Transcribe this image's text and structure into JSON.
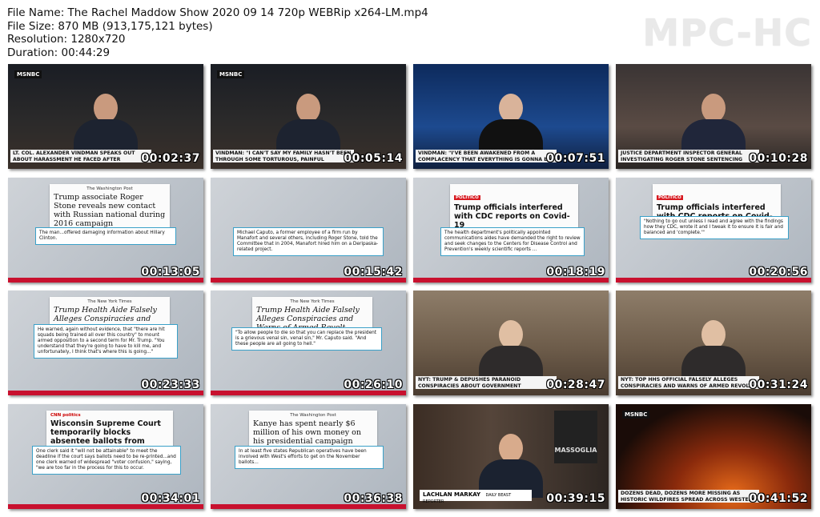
{
  "header": {
    "file_name": "File Name: The Rachel Maddow Show 2020 09 14 720p WEBRip x264-LM.mp4",
    "file_size": "File Size: 870 MB (913,175,121 bytes)",
    "resolution": "Resolution: 1280x720",
    "duration": "Duration: 00:44:29",
    "brand": "MPC-HC"
  },
  "colors": {
    "accent_red": "#c8102e",
    "quote_border": "#3aa0c8"
  },
  "thumbs": [
    {
      "time": "00:02:37",
      "caption": "LT. COL. ALEXANDER VINDMAN SPEAKS OUT ABOUT HARASSMENT HE FACED AFTER TESTIFYING AGAINST TRUMP",
      "network": "MSNBC"
    },
    {
      "time": "00:05:14",
      "caption": "VINDMAN: \"I CAN'T SAY MY FAMILY HASN'T BEEN THROUGH SOME TORTUROUS, PAINFUL MOMENTS\" AFTER IMPEACHMENT TESTIMONY",
      "network": "MSNBC"
    },
    {
      "time": "00:07:51",
      "caption": "VINDMAN: \"I'VE BEEN AWAKENED FROM A COMPLACENCY THAT EVERYTHING IS GONNA BE OK\"",
      "network": "MSNBC"
    },
    {
      "time": "00:10:28",
      "caption": "JUSTICE DEPARTMENT INSPECTOR GENERAL INVESTIGATING ROGER STONE SENTENCING DECISION",
      "network": "MSNBC"
    },
    {
      "time": "00:13:05",
      "source": "The Washington Post",
      "headline": "Trump associate Roger Stone reveals new contact with Russian national during 2016 campaign",
      "quote": "The man...offered damaging information about Hillary Clinton."
    },
    {
      "time": "00:15:42",
      "quote": "Michael Caputo, a former employee of a firm run by Manafort and several others, including Roger Stone, told the Committee that in 2004, Manafort hired him on a Deripaska-related project."
    },
    {
      "time": "00:18:19",
      "source": "POLITICO",
      "headline": "Trump officials interfered with CDC reports on Covid-19",
      "quote": "The health department's politically appointed communications aides have demanded the right to review and seek changes to the Centers for Disease Control and Prevention's weekly scientific reports ..."
    },
    {
      "time": "00:20:56",
      "source": "POLITICO",
      "headline": "Trump officials interfered with CDC reports on Covid-19",
      "quote": "\"Nothing to go out unless I read and agree with the findings how they CDC, wrote it and I tweak it to ensure it is fair and balanced and 'complete.'\""
    },
    {
      "time": "00:23:33",
      "source": "The New York Times",
      "headline": "Trump Health Aide Falsely Alleges Conspiracies and Warns of Armed Revolt",
      "quote": "He warned, again without evidence, that \"there are hit squads being trained all over this country\" to mount armed opposition to a second term for Mr. Trump. \"You understand that they're going to have to kill me, and unfortunately, I think that's where this is going...\""
    },
    {
      "time": "00:26:10",
      "source": "The New York Times",
      "headline": "Trump Health Aide Falsely Alleges Conspiracies and Warns of Armed Revolt",
      "quote": "\"To allow people to die so that you can replace the president is a grievous venal sin, venal sin,\" Mr. Caputo said. \"And these people are all going to hell.\""
    },
    {
      "time": "00:28:47",
      "caption": "NYT: TRUMP & DEPUSHES PARANOID CONSPIRACIES ABOUT GOVERNMENT SCIENTISTS AND LEFT-WING \"HIT SQUADS\"",
      "network": "MSNBC"
    },
    {
      "time": "00:31:24",
      "caption": "NYT: TOP HHS OFFICIAL FALSELY ALLEGES CONSPIRACIES AND WARNS OF ARMED REVOLT",
      "network": "MSNBC"
    },
    {
      "time": "00:34:01",
      "source": "CNN politics",
      "headline": "Wisconsin Supreme Court temporarily blocks absentee ballots from being mailed a week before deadline",
      "quote": "One clerk said it \"will not be attainable\" to meet the deadline if the court says ballots need to be re-printed...and one clerk warned of widespread \"voter confusion,\" saying, \"we are too far in the process for this to occur."
    },
    {
      "time": "00:36:38",
      "source": "The Washington Post",
      "headline": "Kanye has spent nearly $6 million of his own money on his presidential campaign",
      "quote": "In at least five states Republican operatives have been involved with West's efforts to get on the November ballots..."
    },
    {
      "time": "00:39:15",
      "name": "LACHLAN MARKAY",
      "title": "DAILY BEAST REPORTER",
      "poster": "MASSOGLIA",
      "network": "MSNBC"
    },
    {
      "time": "00:41:52",
      "caption": "DOZENS DEAD, DOZENS MORE MISSING AS HISTORIC WILDFIRES SPREAD ACROSS WESTERN U.S.",
      "network": "MSNBC"
    }
  ]
}
